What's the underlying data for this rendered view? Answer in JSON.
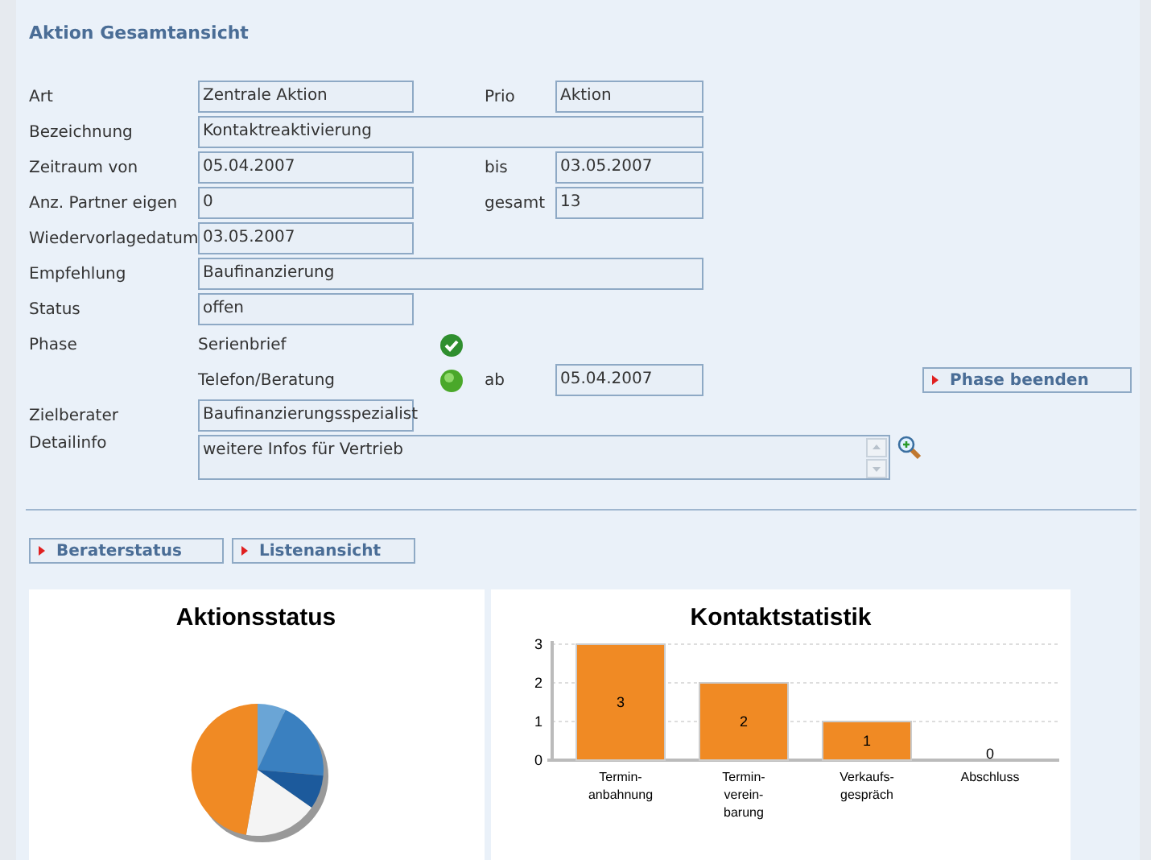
{
  "panel": {
    "title": "Aktion Gesamtansicht"
  },
  "form": {
    "rows": [
      {
        "kind": "pair",
        "label": "Art",
        "value": "Zentrale Aktion",
        "label_2": "Prio",
        "value_2": "Aktion"
      },
      {
        "kind": "wide",
        "label": "Bezeichnung",
        "value": "Kontaktreaktivierung"
      },
      {
        "kind": "pair",
        "label": "Zeitraum von",
        "value": "05.04.2007",
        "label_2": "bis",
        "value_2": "03.05.2007"
      },
      {
        "kind": "pair",
        "label": "Anz. Partner eigen",
        "value": "0",
        "label_2": "gesamt",
        "value_2": "13"
      },
      {
        "kind": "single",
        "label": "Wiedervorlagedatum",
        "value": "03.05.2007"
      },
      {
        "kind": "wide",
        "label": "Empfehlung",
        "value": "Baufinanzierung"
      },
      {
        "kind": "single",
        "label": "Status",
        "value": "offen"
      },
      {
        "kind": "phase",
        "label": "Phase",
        "steps": [
          {
            "name": "Serienbrief",
            "done": true
          },
          {
            "name": "Telefon/Beratung",
            "done": false,
            "since_label": "ab",
            "since": "05.04.2007"
          }
        ],
        "button": {
          "label": "Phase beenden"
        }
      },
      {
        "kind": "single",
        "label": "Zielberater",
        "value": "Baufinanzierungsspezialist"
      },
      {
        "kind": "textarea",
        "label": "Detailinfo",
        "value": "weitere Infos für Vertrieb"
      }
    ]
  },
  "buttons": [
    {
      "label": "Beraterstatus"
    },
    {
      "label": "Listenansicht"
    }
  ],
  "charts": [
    {
      "kind": "pie",
      "title": "Aktionsstatus"
    },
    {
      "kind": "bar",
      "chart_data": {
        "type": "bar",
        "title": "Kontaktstatistik",
        "categories": [
          "Termin-\nanbahnung",
          "Termin-\nverein-\nbarung",
          "Verkaufs-\ngespräch",
          "Abschluss"
        ],
        "series": [
          {
            "color": "#f08a24",
            "values": [
              3,
              2,
              1,
              0
            ]
          }
        ],
        "ylim": [
          0,
          3
        ],
        "yticks": [
          0,
          1,
          2,
          3
        ],
        "data_labels": true
      }
    }
  ]
}
